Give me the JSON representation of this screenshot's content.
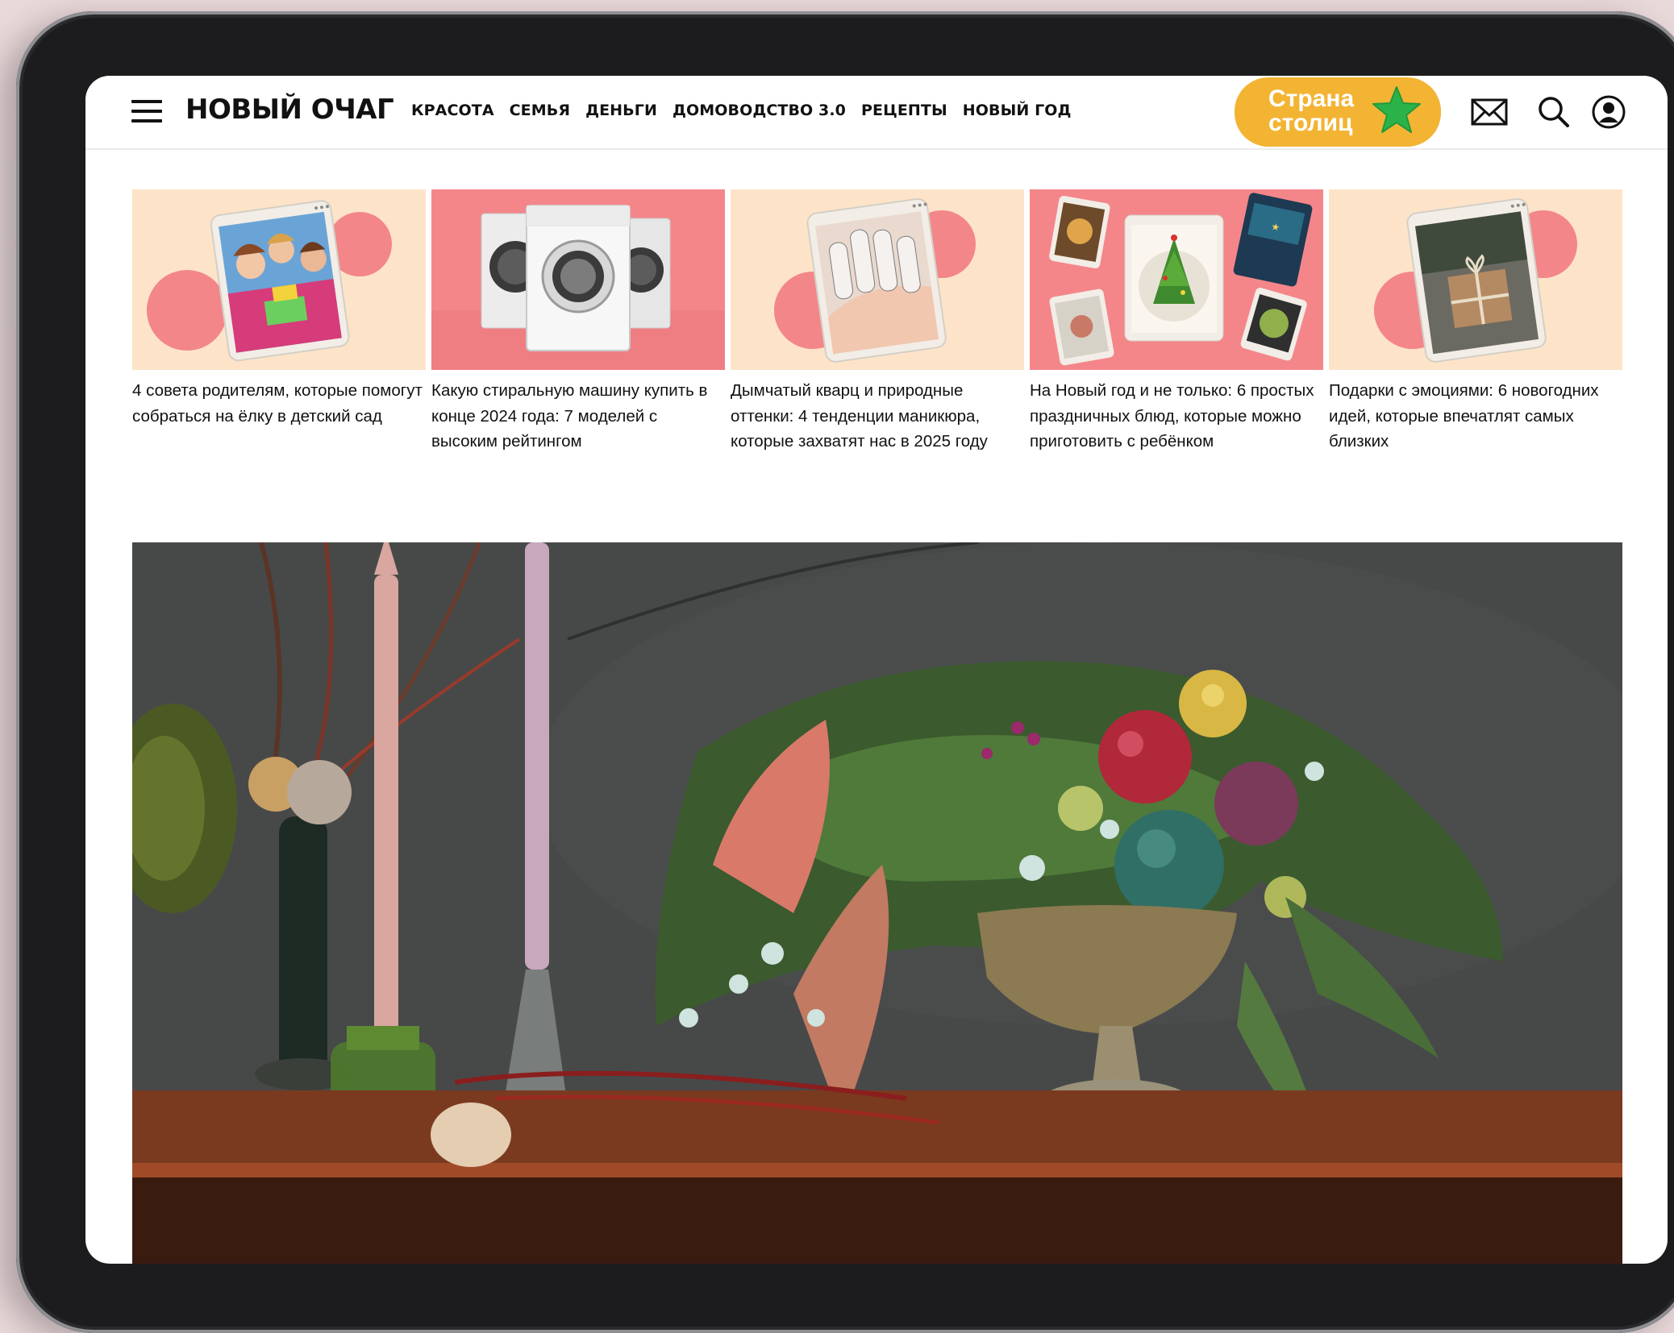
{
  "header": {
    "logo": "НОВЫЙ ОЧАГ",
    "nav": [
      "КРАСОТА",
      "СЕМЬЯ",
      "ДЕНЬГИ",
      "ДОМОВОДСТВО 3.0",
      "РЕЦЕПТЫ",
      "НОВЫЙ ГОД"
    ],
    "promo_line1": "Страна",
    "promo_line2": "столиц",
    "icons": [
      "mail-icon",
      "search-icon",
      "user-icon"
    ]
  },
  "cards": [
    {
      "title": "4 совета родителям, которые помогут собраться на ёлку в детский сад"
    },
    {
      "title": "Какую стиральную машину купить в конце 2024 года: 7 моделей с высоким рейтингом"
    },
    {
      "title": "Дымчатый кварц и природные оттенки: 4 тенденции маникюра, которые захватят нас в 2025 году"
    },
    {
      "title": "На Новый год и не только: 6 простых праздничных блюд, которые можно приготовить с ребёнком"
    },
    {
      "title": "Подарки с эмоциями: 6 новогодних идей, которые впечатлят самых близких"
    }
  ],
  "colors": {
    "peach": "#fde4c8",
    "pink": "#f38689",
    "salmon": "#f07f85",
    "promo": "#f3b434",
    "star": "#2bb34a"
  }
}
